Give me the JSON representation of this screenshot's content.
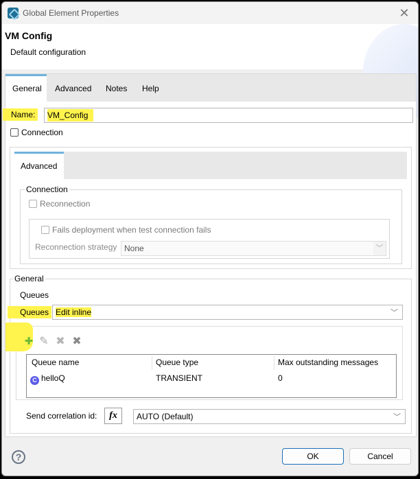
{
  "window": {
    "title": "Global Element Properties",
    "close_glyph": "✕"
  },
  "header": {
    "title": "VM Config",
    "subtitle": "Default configuration"
  },
  "tabs": [
    {
      "label": "General",
      "active": true
    },
    {
      "label": "Advanced",
      "active": false
    },
    {
      "label": "Notes",
      "active": false
    },
    {
      "label": "Help",
      "active": false
    }
  ],
  "general": {
    "name_label": "Name:",
    "name_value": "VM_Config",
    "connection_checkbox_label": "Connection",
    "connection_checked": false,
    "inner_tab_label": "Advanced",
    "connection_group": {
      "title": "Connection",
      "reconnection_label": "Reconnection",
      "fails_deployment_label": "Fails deployment when test connection fails",
      "strategy_label": "Reconnection strategy",
      "strategy_value": "None"
    },
    "general_group": {
      "title": "General",
      "queues_heading": "Queues",
      "queues_label": "Queues",
      "queues_value": "Edit inline",
      "toolbar": {
        "add_glyph": "✚",
        "edit_glyph": "✎",
        "delete_glyph": "✖",
        "delete_all_glyph": "✖"
      },
      "table": {
        "columns": [
          "Queue name",
          "Queue type",
          "Max outstanding messages"
        ],
        "rows": [
          {
            "name": "helloQ",
            "type": "TRANSIENT",
            "max": "0",
            "icon": "queue-icon"
          }
        ]
      },
      "correlation_label": "Send correlation id:",
      "fx_label": "fx",
      "correlation_value": "AUTO (Default)"
    }
  },
  "footer": {
    "help_glyph": "?",
    "ok_label": "OK",
    "cancel_label": "Cancel"
  },
  "colors": {
    "accent": "#6fb2dc",
    "highlight": "#fff34d",
    "primary_border": "#1c6fb8"
  }
}
